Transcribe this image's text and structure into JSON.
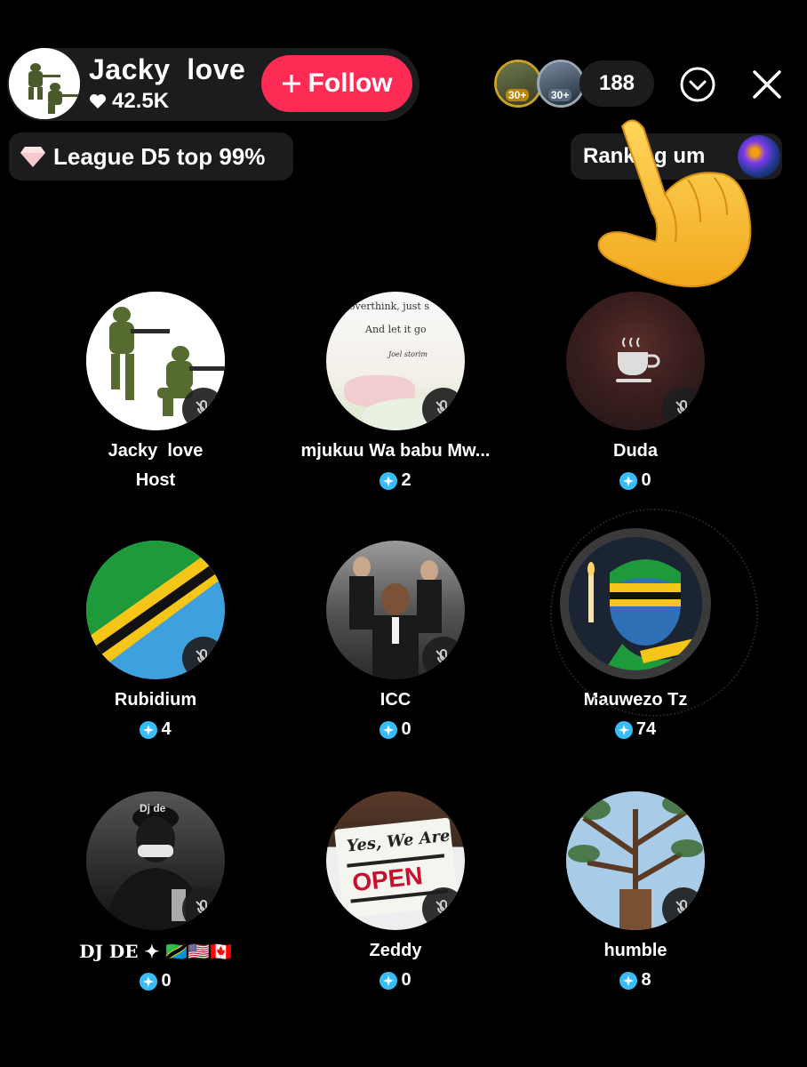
{
  "host": {
    "name": "Jacky  love",
    "likes": "42.5K",
    "follow_label": "Follow"
  },
  "viewers": {
    "badges": [
      "30+",
      "30+"
    ],
    "count": "188"
  },
  "league": {
    "text": "League D5 top 99%"
  },
  "ranking": {
    "label": "Ranking um"
  },
  "seats": [
    {
      "name": "Jacky  love",
      "sub": "Host",
      "gems": null
    },
    {
      "name": "mjukuu Wa babu Mw...",
      "gems": "2"
    },
    {
      "name": "Duda",
      "gems": "0"
    },
    {
      "name": "Rubidium",
      "gems": "4"
    },
    {
      "name": "ICC",
      "gems": "0"
    },
    {
      "name": "Mauwezo Tz",
      "gems": "74"
    },
    {
      "name": "DJ DE ✦ 🇹🇿🇺🇸🇨🇦",
      "gems": "0"
    },
    {
      "name": "Zeddy",
      "gems": "0"
    },
    {
      "name": "humble",
      "gems": "8"
    }
  ],
  "images": {
    "note_line1": "t overthink, just s",
    "note_line2": "And let it go",
    "note_sign": "Joel storim",
    "shirt_text": "Dj de",
    "sign_line1": "Yes, We Are",
    "sign_line2": "OPEN"
  },
  "colors": {
    "follow": "#fe2c55",
    "pill_bg": "#1c1c1e",
    "gem": "#38bdf8"
  },
  "icons": [
    "heart-icon",
    "plus-icon",
    "chevron-down-icon",
    "close-icon",
    "diamond-icon",
    "mic-off-icon",
    "gem-icon",
    "coffee-icon",
    "pointing-hand-icon"
  ]
}
